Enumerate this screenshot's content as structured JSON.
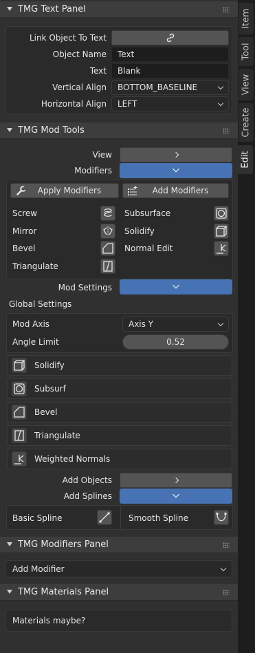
{
  "tabs": [
    {
      "label": "Item",
      "active": false
    },
    {
      "label": "Tool",
      "active": false
    },
    {
      "label": "View",
      "active": false
    },
    {
      "label": "Create",
      "active": false
    },
    {
      "label": "Edit",
      "active": true
    }
  ],
  "text_panel": {
    "title": "TMG Text Panel",
    "link_label": "Link Object To Text",
    "link_icon": "link-icon",
    "object_name_label": "Object Name",
    "object_name_value": "Text",
    "text_label": "Text",
    "text_value": "Blank",
    "valign_label": "Vertical Align",
    "valign_value": "BOTTOM_BASELINE",
    "halign_label": "Horizontal Align",
    "halign_value": "LEFT"
  },
  "mod_tools": {
    "title": "TMG Mod Tools",
    "view_label": "View",
    "modifiers_label": "Modifiers",
    "apply_label": "Apply Modifiers",
    "add_label": "Add Modifiers",
    "modifiers_left": [
      "Screw",
      "Mirror",
      "Bevel",
      "Triangulate"
    ],
    "modifiers_right": [
      "Subsurface",
      "Solidify",
      "Normal Edit"
    ],
    "mod_settings_label": "Mod Settings",
    "global_settings_label": "Global Settings",
    "mod_axis_label": "Mod Axis",
    "mod_axis_value": "Axis Y",
    "angle_limit_label": "Angle Limit",
    "angle_limit_value": "0.52",
    "mod_rows": [
      "Solidify",
      "Subsurf",
      "Bevel",
      "Triangulate",
      "Weighted Normals"
    ],
    "add_objects_label": "Add Objects",
    "add_splines_label": "Add Splines",
    "basic_spline_label": "Basic Spline",
    "smooth_spline_label": "Smooth Spline"
  },
  "modifiers_panel": {
    "title": "TMG Modifiers Panel",
    "add_modifier_value": "Add Modifier"
  },
  "materials_panel": {
    "title": "TMG Materials Panel",
    "note": "Materials maybe?"
  },
  "colors": {
    "accent_blue": "#4772b3",
    "panel_bg": "#303030",
    "header_bg": "#3d3d3d"
  }
}
